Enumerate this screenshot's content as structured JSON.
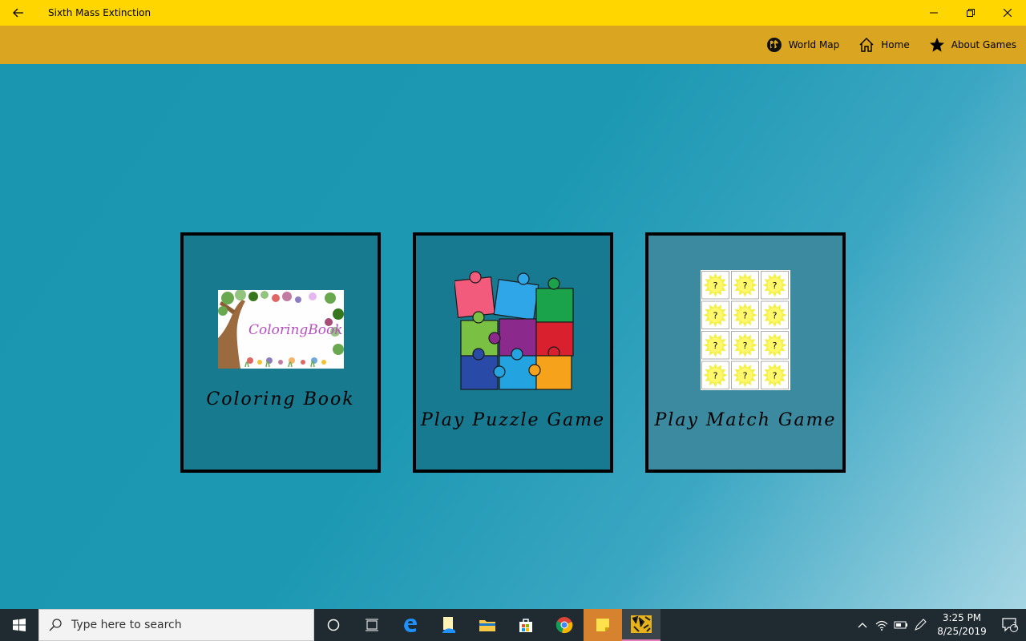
{
  "window": {
    "title": "Sixth Mass Extinction",
    "back_icon": "arrow-left-icon",
    "controls": [
      "minimize-icon",
      "restore-icon",
      "close-icon"
    ]
  },
  "cmdbar": {
    "items": [
      {
        "label": "World Map",
        "icon": "globe-icon"
      },
      {
        "label": "Home",
        "icon": "home-icon"
      },
      {
        "label": "About Games",
        "icon": "star-icon"
      }
    ]
  },
  "cards": [
    {
      "label": "Coloring Book",
      "image_text": "ColoringBook"
    },
    {
      "label": "Play Puzzle Game"
    },
    {
      "label": "Play Match Game",
      "tile_mark": "?"
    }
  ],
  "taskbar": {
    "search_placeholder": "Type here to search",
    "time": "3:25 PM",
    "date": "8/25/2019",
    "notification_count": "1"
  },
  "colors": {
    "titlebar": "#ffd600",
    "cmdbar": "#daa520",
    "background": "#1a98b2"
  }
}
